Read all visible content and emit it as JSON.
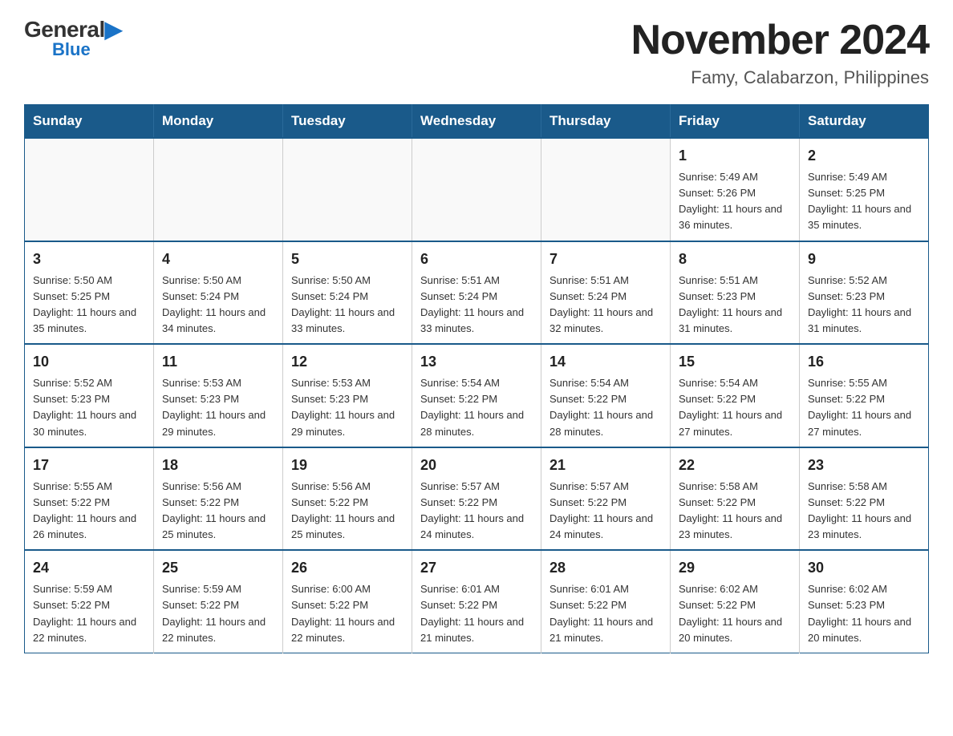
{
  "logo": {
    "general": "General",
    "blue": "Blue",
    "triangle": "▶"
  },
  "title": "November 2024",
  "subtitle": "Famy, Calabarzon, Philippines",
  "days_of_week": [
    "Sunday",
    "Monday",
    "Tuesday",
    "Wednesday",
    "Thursday",
    "Friday",
    "Saturday"
  ],
  "weeks": [
    [
      {
        "day": "",
        "info": ""
      },
      {
        "day": "",
        "info": ""
      },
      {
        "day": "",
        "info": ""
      },
      {
        "day": "",
        "info": ""
      },
      {
        "day": "",
        "info": ""
      },
      {
        "day": "1",
        "info": "Sunrise: 5:49 AM\nSunset: 5:26 PM\nDaylight: 11 hours and 36 minutes."
      },
      {
        "day": "2",
        "info": "Sunrise: 5:49 AM\nSunset: 5:25 PM\nDaylight: 11 hours and 35 minutes."
      }
    ],
    [
      {
        "day": "3",
        "info": "Sunrise: 5:50 AM\nSunset: 5:25 PM\nDaylight: 11 hours and 35 minutes."
      },
      {
        "day": "4",
        "info": "Sunrise: 5:50 AM\nSunset: 5:24 PM\nDaylight: 11 hours and 34 minutes."
      },
      {
        "day": "5",
        "info": "Sunrise: 5:50 AM\nSunset: 5:24 PM\nDaylight: 11 hours and 33 minutes."
      },
      {
        "day": "6",
        "info": "Sunrise: 5:51 AM\nSunset: 5:24 PM\nDaylight: 11 hours and 33 minutes."
      },
      {
        "day": "7",
        "info": "Sunrise: 5:51 AM\nSunset: 5:24 PM\nDaylight: 11 hours and 32 minutes."
      },
      {
        "day": "8",
        "info": "Sunrise: 5:51 AM\nSunset: 5:23 PM\nDaylight: 11 hours and 31 minutes."
      },
      {
        "day": "9",
        "info": "Sunrise: 5:52 AM\nSunset: 5:23 PM\nDaylight: 11 hours and 31 minutes."
      }
    ],
    [
      {
        "day": "10",
        "info": "Sunrise: 5:52 AM\nSunset: 5:23 PM\nDaylight: 11 hours and 30 minutes."
      },
      {
        "day": "11",
        "info": "Sunrise: 5:53 AM\nSunset: 5:23 PM\nDaylight: 11 hours and 29 minutes."
      },
      {
        "day": "12",
        "info": "Sunrise: 5:53 AM\nSunset: 5:23 PM\nDaylight: 11 hours and 29 minutes."
      },
      {
        "day": "13",
        "info": "Sunrise: 5:54 AM\nSunset: 5:22 PM\nDaylight: 11 hours and 28 minutes."
      },
      {
        "day": "14",
        "info": "Sunrise: 5:54 AM\nSunset: 5:22 PM\nDaylight: 11 hours and 28 minutes."
      },
      {
        "day": "15",
        "info": "Sunrise: 5:54 AM\nSunset: 5:22 PM\nDaylight: 11 hours and 27 minutes."
      },
      {
        "day": "16",
        "info": "Sunrise: 5:55 AM\nSunset: 5:22 PM\nDaylight: 11 hours and 27 minutes."
      }
    ],
    [
      {
        "day": "17",
        "info": "Sunrise: 5:55 AM\nSunset: 5:22 PM\nDaylight: 11 hours and 26 minutes."
      },
      {
        "day": "18",
        "info": "Sunrise: 5:56 AM\nSunset: 5:22 PM\nDaylight: 11 hours and 25 minutes."
      },
      {
        "day": "19",
        "info": "Sunrise: 5:56 AM\nSunset: 5:22 PM\nDaylight: 11 hours and 25 minutes."
      },
      {
        "day": "20",
        "info": "Sunrise: 5:57 AM\nSunset: 5:22 PM\nDaylight: 11 hours and 24 minutes."
      },
      {
        "day": "21",
        "info": "Sunrise: 5:57 AM\nSunset: 5:22 PM\nDaylight: 11 hours and 24 minutes."
      },
      {
        "day": "22",
        "info": "Sunrise: 5:58 AM\nSunset: 5:22 PM\nDaylight: 11 hours and 23 minutes."
      },
      {
        "day": "23",
        "info": "Sunrise: 5:58 AM\nSunset: 5:22 PM\nDaylight: 11 hours and 23 minutes."
      }
    ],
    [
      {
        "day": "24",
        "info": "Sunrise: 5:59 AM\nSunset: 5:22 PM\nDaylight: 11 hours and 22 minutes."
      },
      {
        "day": "25",
        "info": "Sunrise: 5:59 AM\nSunset: 5:22 PM\nDaylight: 11 hours and 22 minutes."
      },
      {
        "day": "26",
        "info": "Sunrise: 6:00 AM\nSunset: 5:22 PM\nDaylight: 11 hours and 22 minutes."
      },
      {
        "day": "27",
        "info": "Sunrise: 6:01 AM\nSunset: 5:22 PM\nDaylight: 11 hours and 21 minutes."
      },
      {
        "day": "28",
        "info": "Sunrise: 6:01 AM\nSunset: 5:22 PM\nDaylight: 11 hours and 21 minutes."
      },
      {
        "day": "29",
        "info": "Sunrise: 6:02 AM\nSunset: 5:22 PM\nDaylight: 11 hours and 20 minutes."
      },
      {
        "day": "30",
        "info": "Sunrise: 6:02 AM\nSunset: 5:23 PM\nDaylight: 11 hours and 20 minutes."
      }
    ]
  ]
}
